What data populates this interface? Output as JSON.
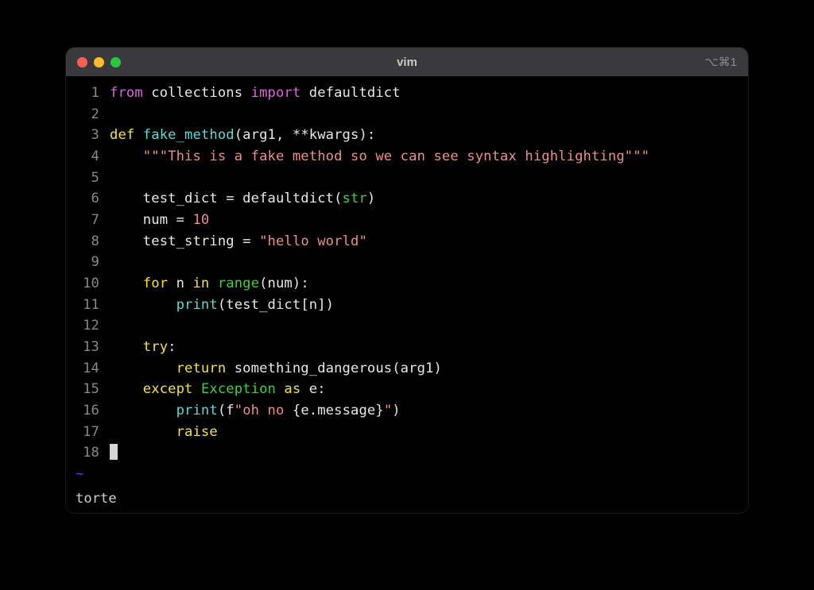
{
  "window": {
    "title": "vim",
    "shortcut": "⌥⌘1"
  },
  "editor": {
    "lines": {
      "l1": {
        "num": "1",
        "t1": "from",
        "t2": " collections ",
        "t3": "import",
        "t4": " defaultdict"
      },
      "l2": {
        "num": "2"
      },
      "l3": {
        "num": "3",
        "t1": "def",
        "t2": " ",
        "t3": "fake_method",
        "t4": "(arg1, **kwargs):"
      },
      "l4": {
        "num": "4",
        "indent": "    ",
        "t1": "\"\"\"This is a fake method so we can see syntax highlighting\"\"\""
      },
      "l5": {
        "num": "5"
      },
      "l6": {
        "num": "6",
        "indent": "    ",
        "t1": "test_dict = defaultdict(",
        "t2": "str",
        "t3": ")"
      },
      "l7": {
        "num": "7",
        "indent": "    ",
        "t1": "num = ",
        "t2": "10"
      },
      "l8": {
        "num": "8",
        "indent": "    ",
        "t1": "test_string = ",
        "t2": "\"hello world\""
      },
      "l9": {
        "num": "9"
      },
      "l10": {
        "num": "10",
        "indent": "    ",
        "t1": "for",
        "t2": " n ",
        "t3": "in",
        "t4": " ",
        "t5": "range",
        "t6": "(num):"
      },
      "l11": {
        "num": "11",
        "indent": "        ",
        "t1": "print",
        "t2": "(test_dict[n])"
      },
      "l12": {
        "num": "12"
      },
      "l13": {
        "num": "13",
        "indent": "    ",
        "t1": "try",
        "t2": ":"
      },
      "l14": {
        "num": "14",
        "indent": "        ",
        "t1": "return",
        "t2": " something_dangerous(arg1)"
      },
      "l15": {
        "num": "15",
        "indent": "    ",
        "t1": "except",
        "t2": " ",
        "t3": "Exception",
        "t4": " ",
        "t5": "as",
        "t6": " e:"
      },
      "l16": {
        "num": "16",
        "indent": "        ",
        "t1": "print",
        "t2": "(f",
        "t3": "\"oh no ",
        "t4": "{e.message}",
        "t5": "\"",
        "t6": ")"
      },
      "l17": {
        "num": "17",
        "indent": "        ",
        "t1": "raise"
      },
      "l18": {
        "num": "18"
      }
    },
    "tilde": "~"
  },
  "status": {
    "text": "torte"
  }
}
